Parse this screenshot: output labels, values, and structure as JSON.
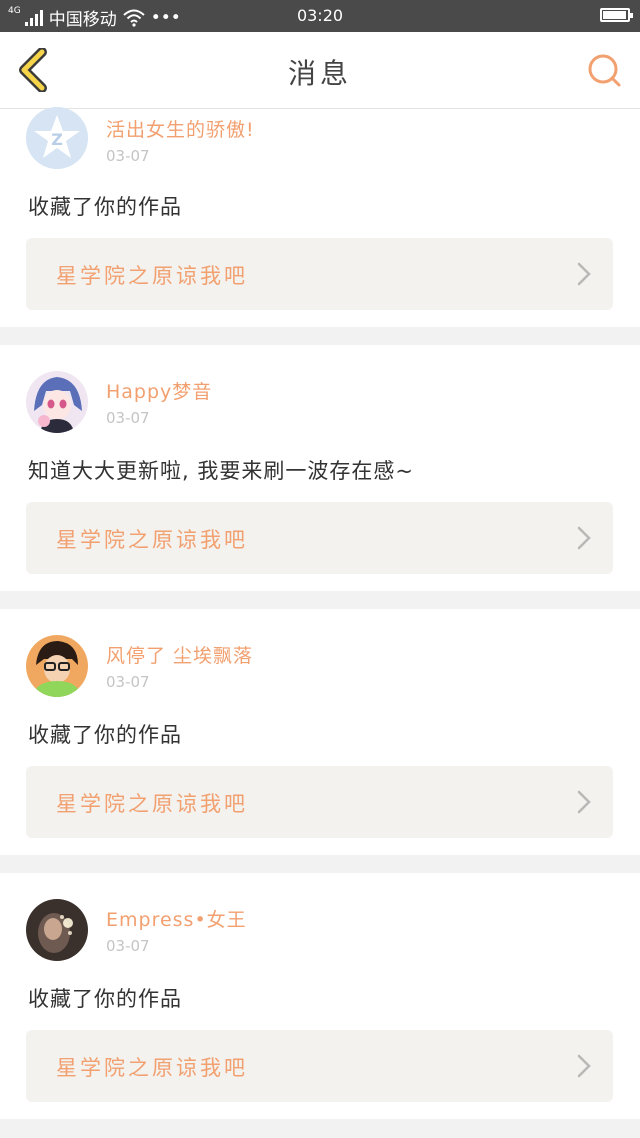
{
  "status_bar": {
    "network": "4G",
    "carrier": "中国移动",
    "dots": "•••",
    "time": "03:20"
  },
  "header": {
    "title": "消息",
    "back_icon": "chevron-left-icon",
    "search_icon": "search-icon"
  },
  "colors": {
    "accent": "#f2a070",
    "back_icon": "#f5d44a",
    "card_bg": "#f3f2ee"
  },
  "messages": [
    {
      "username": "活出女生的骄傲!",
      "date": "03-07",
      "message": "收藏了你的作品",
      "work_title": "星学院之原谅我吧"
    },
    {
      "username": "Happy梦音",
      "date": "03-07",
      "message": "知道大大更新啦, 我要来刷一波存在感~",
      "work_title": "星学院之原谅我吧"
    },
    {
      "username": "风停了 尘埃飘落",
      "date": "03-07",
      "message": "收藏了你的作品",
      "work_title": "星学院之原谅我吧"
    },
    {
      "username": "Empress•女王",
      "date": "03-07",
      "message": "收藏了你的作品",
      "work_title": "星学院之原谅我吧"
    }
  ]
}
